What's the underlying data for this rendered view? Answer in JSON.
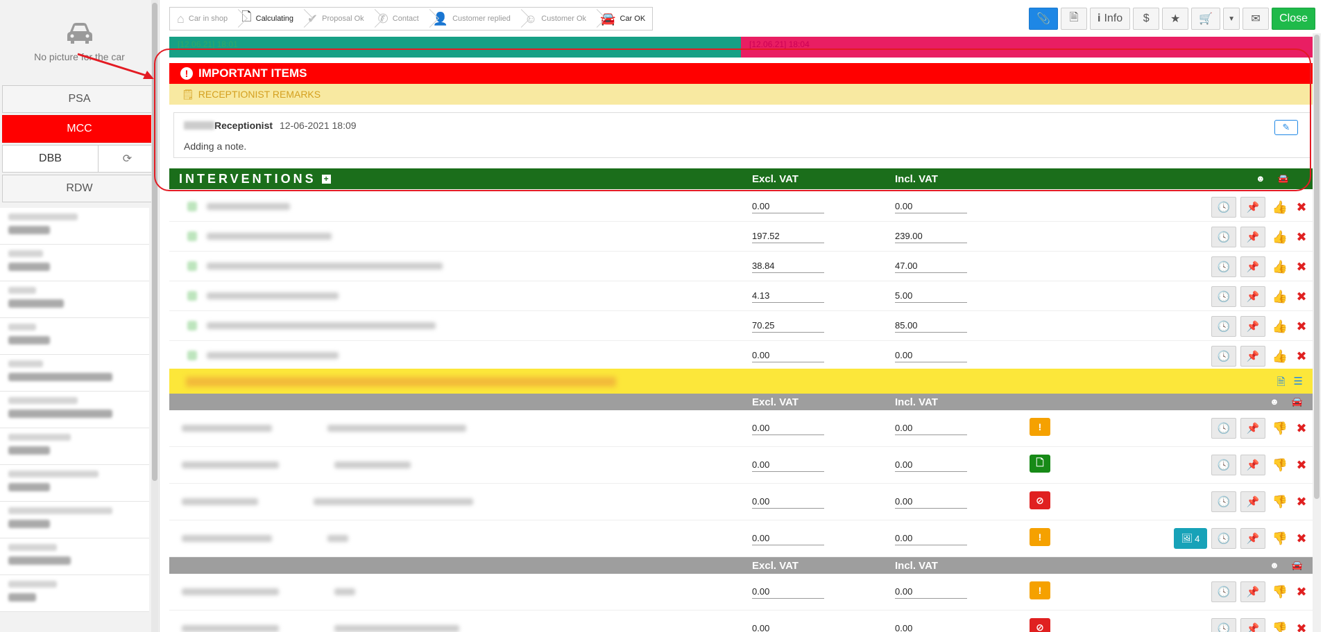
{
  "left": {
    "no_picture": "No picture for the car",
    "sources": {
      "psa": "PSA",
      "mcc": "MCC",
      "dbb": "DBB",
      "rdw": "RDW"
    }
  },
  "steps": [
    {
      "label": "Car in shop",
      "icon": "garage-icon"
    },
    {
      "label": "Calculating",
      "icon": "document-icon"
    },
    {
      "label": "Proposal Ok",
      "icon": "check-icon"
    },
    {
      "label": "Contact",
      "icon": "phone-icon"
    },
    {
      "label": "Customer replied",
      "icon": "user-check-icon"
    },
    {
      "label": "Customer Ok",
      "icon": "smiley-icon"
    },
    {
      "label": "Car OK",
      "icon": "car-icon"
    }
  ],
  "actions": {
    "info": "Info",
    "dollar": "$",
    "close": "Close"
  },
  "timeline": {
    "a": "[12.06.21] 18:01",
    "b": "[12.06.21] 18:04"
  },
  "important": {
    "title": "IMPORTANT ITEMS",
    "remarks": "RECEPTIONIST REMARKS",
    "note": {
      "author": "Receptionist",
      "date": "12-06-2021 18:09",
      "text": "Adding a note."
    }
  },
  "interventions": {
    "title": "INTERVENTIONS",
    "excl": "Excl. VAT",
    "incl": "Incl. VAT",
    "rows": [
      {
        "excl": "0.00",
        "incl": "0.00"
      },
      {
        "excl": "197.52",
        "incl": "239.00"
      },
      {
        "excl": "38.84",
        "incl": "47.00"
      },
      {
        "excl": "4.13",
        "incl": "5.00"
      },
      {
        "excl": "70.25",
        "incl": "85.00"
      },
      {
        "excl": "0.00",
        "incl": "0.00"
      }
    ]
  },
  "group1": {
    "excl": "Excl. VAT",
    "incl": "Incl. VAT",
    "rows": [
      {
        "excl": "0.00",
        "incl": "0.00",
        "status": "warning"
      },
      {
        "excl": "0.00",
        "incl": "0.00",
        "status": "document"
      },
      {
        "excl": "0.00",
        "incl": "0.00",
        "status": "blocked"
      },
      {
        "excl": "0.00",
        "incl": "0.00",
        "status": "warning",
        "photos": "4"
      }
    ]
  },
  "group2": {
    "excl": "Excl. VAT",
    "incl": "Incl. VAT",
    "rows": [
      {
        "excl": "0.00",
        "incl": "0.00",
        "status": "warning"
      },
      {
        "excl": "0.00",
        "incl": "0.00",
        "status": "blocked"
      }
    ]
  },
  "colors": {
    "important_red": "#ff0000",
    "interventions_green": "#1b6e1b",
    "close_green": "#1fba4a",
    "active_blue": "#1e87e5",
    "annotation_red": "#e31b23"
  }
}
